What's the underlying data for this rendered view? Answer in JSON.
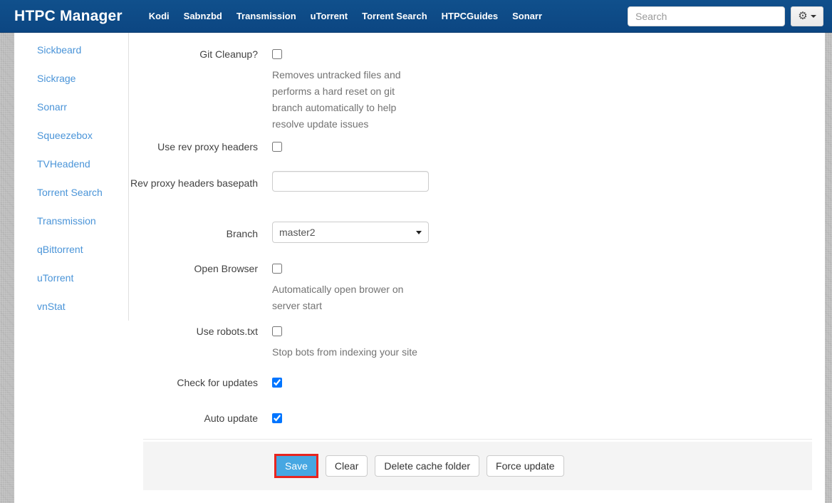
{
  "navbar": {
    "brand": "HTPC Manager",
    "items": [
      "Kodi",
      "Sabnzbd",
      "Transmission",
      "uTorrent",
      "Torrent Search",
      "HTPCGuides",
      "Sonarr"
    ],
    "search": {
      "placeholder": "Search",
      "value": ""
    },
    "settings_menu": {
      "icon": "gears-icon",
      "caret": "caret-down-icon",
      "gear_glyph": "⚙"
    }
  },
  "sidebar": {
    "items": [
      "Sickbeard",
      "Sickrage",
      "Sonarr",
      "Squeezebox",
      "TVHeadend",
      "Torrent Search",
      "Transmission",
      "qBittorrent",
      "uTorrent",
      "vnStat"
    ]
  },
  "form": {
    "fields": {
      "git_cleanup": {
        "label": "Git Cleanup?",
        "checked": false,
        "help": "Removes untracked files and performs a hard reset on git branch automatically to help resolve update issues"
      },
      "use_rev_proxy": {
        "label": "Use rev proxy headers",
        "checked": false
      },
      "rev_proxy_basepath": {
        "label": "Rev proxy headers basepath",
        "value": "",
        "placeholder": ""
      },
      "branch": {
        "label": "Branch",
        "value": "master2"
      },
      "open_browser": {
        "label": "Open Browser",
        "checked": false,
        "help": "Automatically open brower on server start"
      },
      "use_robots": {
        "label": "Use robots.txt",
        "checked": false,
        "help": "Stop bots from indexing your site"
      },
      "check_updates": {
        "label": "Check for updates",
        "checked": true
      },
      "auto_update": {
        "label": "Auto update",
        "checked": true
      }
    }
  },
  "footer": {
    "buttons": {
      "save": "Save",
      "clear": "Clear",
      "delete_cache": "Delete cache folder",
      "force_update": "Force update"
    }
  },
  "annotation": {
    "target": "save-button",
    "color": "#e8251f"
  },
  "colors": {
    "navbar_bg": "#0d4c87",
    "sidebar_link": "#4a94d8",
    "save_button_bg": "#46a7e2",
    "footer_bg": "#f4f4f4",
    "help_text": "#737373"
  }
}
